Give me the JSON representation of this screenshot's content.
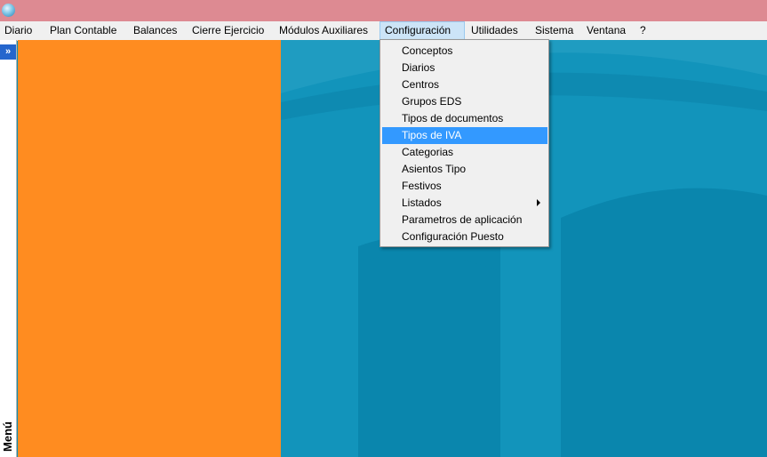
{
  "menubar": {
    "items": [
      {
        "label": "Diario"
      },
      {
        "label": "Plan Contable"
      },
      {
        "label": "Balances"
      },
      {
        "label": "Cierre Ejercicio"
      },
      {
        "label": "Módulos Auxiliares"
      },
      {
        "label": "Configuración"
      },
      {
        "label": "Utilidades"
      },
      {
        "label": "Sistema"
      },
      {
        "label": "Ventana"
      },
      {
        "label": "?"
      }
    ]
  },
  "sidepanel": {
    "toggle_glyph": "»",
    "label": "Menú"
  },
  "config_menu": {
    "items": [
      {
        "label": "Conceptos"
      },
      {
        "label": "Diarios"
      },
      {
        "label": "Centros"
      },
      {
        "label": "Grupos EDS"
      },
      {
        "label": "Tipos de documentos"
      },
      {
        "label": "Tipos de IVA"
      },
      {
        "label": "Categorias"
      },
      {
        "label": "Asientos Tipo"
      },
      {
        "label": "Festivos"
      },
      {
        "label": "Listados"
      },
      {
        "label": "Parametros de aplicación"
      },
      {
        "label": "Configuración Puesto"
      }
    ],
    "selected_index": 5
  },
  "colors": {
    "titlebar": "#dd8a92",
    "orange_panel": "#ff8c20",
    "background": "#1294bb",
    "highlight": "#3399ff"
  }
}
